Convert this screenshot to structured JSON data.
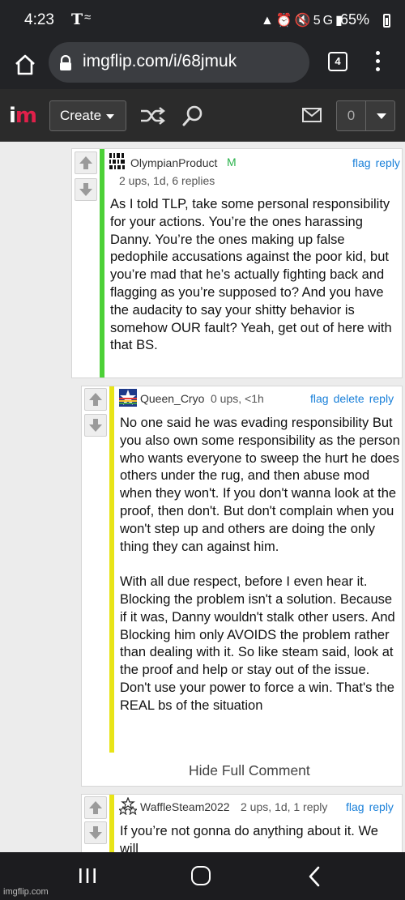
{
  "status_bar": {
    "time": "4:23",
    "carrier": "T",
    "network": "5G",
    "battery": "65%"
  },
  "browser": {
    "url": "imgflip.com/i/68jmuk",
    "tab_count": "4"
  },
  "header": {
    "logo_i": "i",
    "logo_m": "m",
    "create_label": "Create",
    "notification_count": "0"
  },
  "comments": [
    {
      "username": "OlympianProduct",
      "badge": "M",
      "meta": "2 ups, 1d, 6 replies",
      "actions": [
        "flag",
        "reply"
      ],
      "bar_color": "#4cd137",
      "paragraphs": [
        "As I told TLP, take some personal responsibility for your actions. You’re the ones harassing Danny. You’re the ones making up false pedophile accusations against the poor kid, but you’re mad that he’s actually fighting back and flagging as you’re supposed to? And you have the audacity to say your shitty behavior is somehow OUR fault? Yeah, get out of here with that BS."
      ]
    },
    {
      "username": "Queen_Cryo",
      "meta": "0 ups, <1h",
      "actions": [
        "flag",
        "delete",
        "reply"
      ],
      "bar_color": "#e8e417",
      "paragraphs": [
        "No one said he was evading responsibility But you also own some responsibility as the person who wants everyone to sweep the hurt he does others under the rug, and then abuse mod when they won't. If you don't wanna look at the proof, then don't. But don't complain when you won't step up and others are doing the only thing they can against him.",
        "With all due respect, before I even hear it. Blocking the problem isn't a solution. Because if it was, Danny wouldn't stalk other users. And Blocking him only AVOIDS the problem rather than dealing with it. So like steam said, look at the proof and help or stay out of the issue. Don't use your power to force a win. That's the REAL bs of the situation"
      ],
      "hide_label": "Hide Full Comment"
    },
    {
      "username": "WaffleSteam2022",
      "meta": "2 ups, 1d, 1 reply",
      "actions": [
        "flag",
        "reply"
      ],
      "bar_color": "#e8e417",
      "paragraphs": [
        "If you’re not gonna do anything about it. We will"
      ]
    }
  ],
  "watermark": "imgflip.com",
  "colors": {
    "accent_link": "#1a80d9",
    "logo_red": "#e0204a",
    "mod_green": "#2bb24c"
  }
}
